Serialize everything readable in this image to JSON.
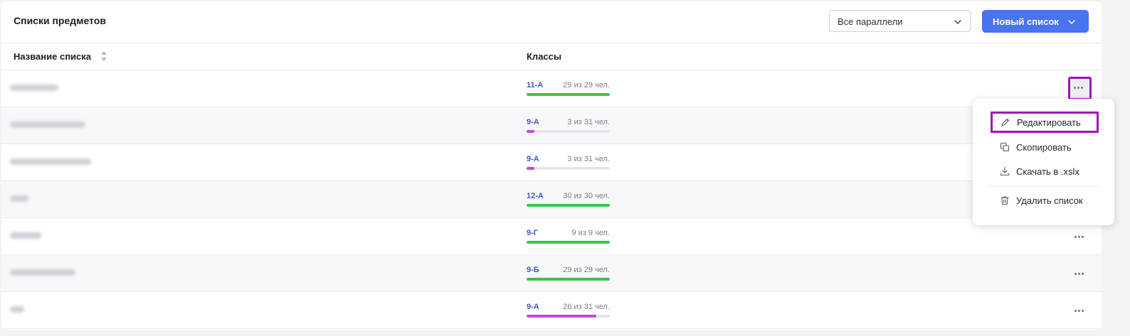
{
  "header": {
    "title": "Списки предметов",
    "filter_value": "Все параллели",
    "new_list_label": "Новый список"
  },
  "table": {
    "col_name": "Название списка",
    "col_classes": "Классы",
    "rows": [
      {
        "class": "11-А",
        "count": "29 из 29 чел.",
        "fill": 1.0,
        "color": "#3cc449"
      },
      {
        "class": "9-А",
        "count": "3 из 31 чел.",
        "fill": 0.0968,
        "color": "#c24ad8"
      },
      {
        "class": "9-А",
        "count": "3 из 31 чел.",
        "fill": 0.0968,
        "color": "#c24ad8"
      },
      {
        "class": "12-А",
        "count": "30 из 30 чел.",
        "fill": 1.0,
        "color": "#3cc449"
      },
      {
        "class": "9-Г",
        "count": "9 из 9 чел.",
        "fill": 1.0,
        "color": "#3cc449"
      },
      {
        "class": "9-Б",
        "count": "29 из 29 чел.",
        "fill": 1.0,
        "color": "#3cc449"
      },
      {
        "class": "9-А",
        "count": "26 из 31 чел.",
        "fill": 0.8387,
        "color": "#c24ad8"
      }
    ]
  },
  "context_menu": {
    "edit": "Редактировать",
    "copy": "Скопировать",
    "download": "Скачать в .xslx",
    "delete": "Удалить список"
  },
  "colors": {
    "accent": "#4a73f2",
    "highlight": "#a212b8",
    "complete": "#3cc449",
    "partial": "#c24ad8"
  }
}
